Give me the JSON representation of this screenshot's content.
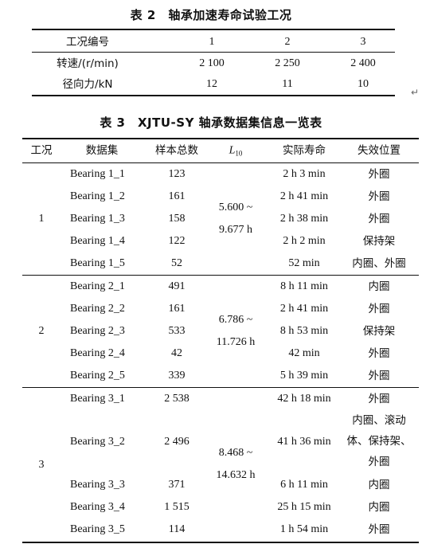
{
  "table2": {
    "caption": "表 2　轴承加速寿命试验工况",
    "header": [
      "工况编号",
      "1",
      "2",
      "3"
    ],
    "rows": [
      [
        "转速/(r/min)",
        "2 100",
        "2 250",
        "2 400"
      ],
      [
        "径向力/kN",
        "12",
        "11",
        "10"
      ]
    ]
  },
  "return_mark": "↵",
  "table3": {
    "caption": "表 3　XJTU-SY 轴承数据集信息一览表",
    "headers": {
      "condition": "工况",
      "dataset": "数据集",
      "samples": "样本总数",
      "L_main": "L",
      "L_sub": "10",
      "life": "实际寿命",
      "failure": "失效位置"
    },
    "groups": [
      {
        "condition": "1",
        "L10_line1": "5.600 ~",
        "L10_line2": "9.677 h",
        "rows": [
          {
            "dataset": "Bearing 1_1",
            "samples": "123",
            "life": "2 h 3 min",
            "failure": "外圈"
          },
          {
            "dataset": "Bearing 1_2",
            "samples": "161",
            "life": "2 h 41 min",
            "failure": "外圈"
          },
          {
            "dataset": "Bearing 1_3",
            "samples": "158",
            "life": "2 h 38 min",
            "failure": "外圈"
          },
          {
            "dataset": "Bearing 1_4",
            "samples": "122",
            "life": "2 h 2 min",
            "failure": "保持架"
          },
          {
            "dataset": "Bearing 1_5",
            "samples": "52",
            "life": "52 min",
            "failure": "内圈、外圈"
          }
        ]
      },
      {
        "condition": "2",
        "L10_line1": "6.786 ~",
        "L10_line2": "11.726 h",
        "rows": [
          {
            "dataset": "Bearing 2_1",
            "samples": "491",
            "life": "8 h 11 min",
            "failure": "内圈"
          },
          {
            "dataset": "Bearing 2_2",
            "samples": "161",
            "life": "2 h 41 min",
            "failure": "外圈"
          },
          {
            "dataset": "Bearing 2_3",
            "samples": "533",
            "life": "8 h 53 min",
            "failure": "保持架"
          },
          {
            "dataset": "Bearing 2_4",
            "samples": "42",
            "life": "42 min",
            "failure": "外圈"
          },
          {
            "dataset": "Bearing 2_5",
            "samples": "339",
            "life": "5 h 39 min",
            "failure": "外圈"
          }
        ]
      },
      {
        "condition": "3",
        "L10_line1": "8.468 ~",
        "L10_line2": "14.632 h",
        "rows": [
          {
            "dataset": "Bearing 3_1",
            "samples": "2 538",
            "life": "42 h 18 min",
            "failure": "外圈"
          },
          {
            "dataset": "Bearing 3_2",
            "samples": "2 496",
            "life": "41 h 36 min",
            "failure_lines": [
              "内圈、滚动",
              "体、保持架、",
              "外圈"
            ]
          },
          {
            "dataset": "Bearing 3_3",
            "samples": "371",
            "life": "6 h 11 min",
            "failure": "内圈"
          },
          {
            "dataset": "Bearing 3_4",
            "samples": "1 515",
            "life": "25 h 15 min",
            "failure": "内圈"
          },
          {
            "dataset": "Bearing 3_5",
            "samples": "114",
            "life": "1 h 54 min",
            "failure": "外圈"
          }
        ]
      }
    ]
  }
}
